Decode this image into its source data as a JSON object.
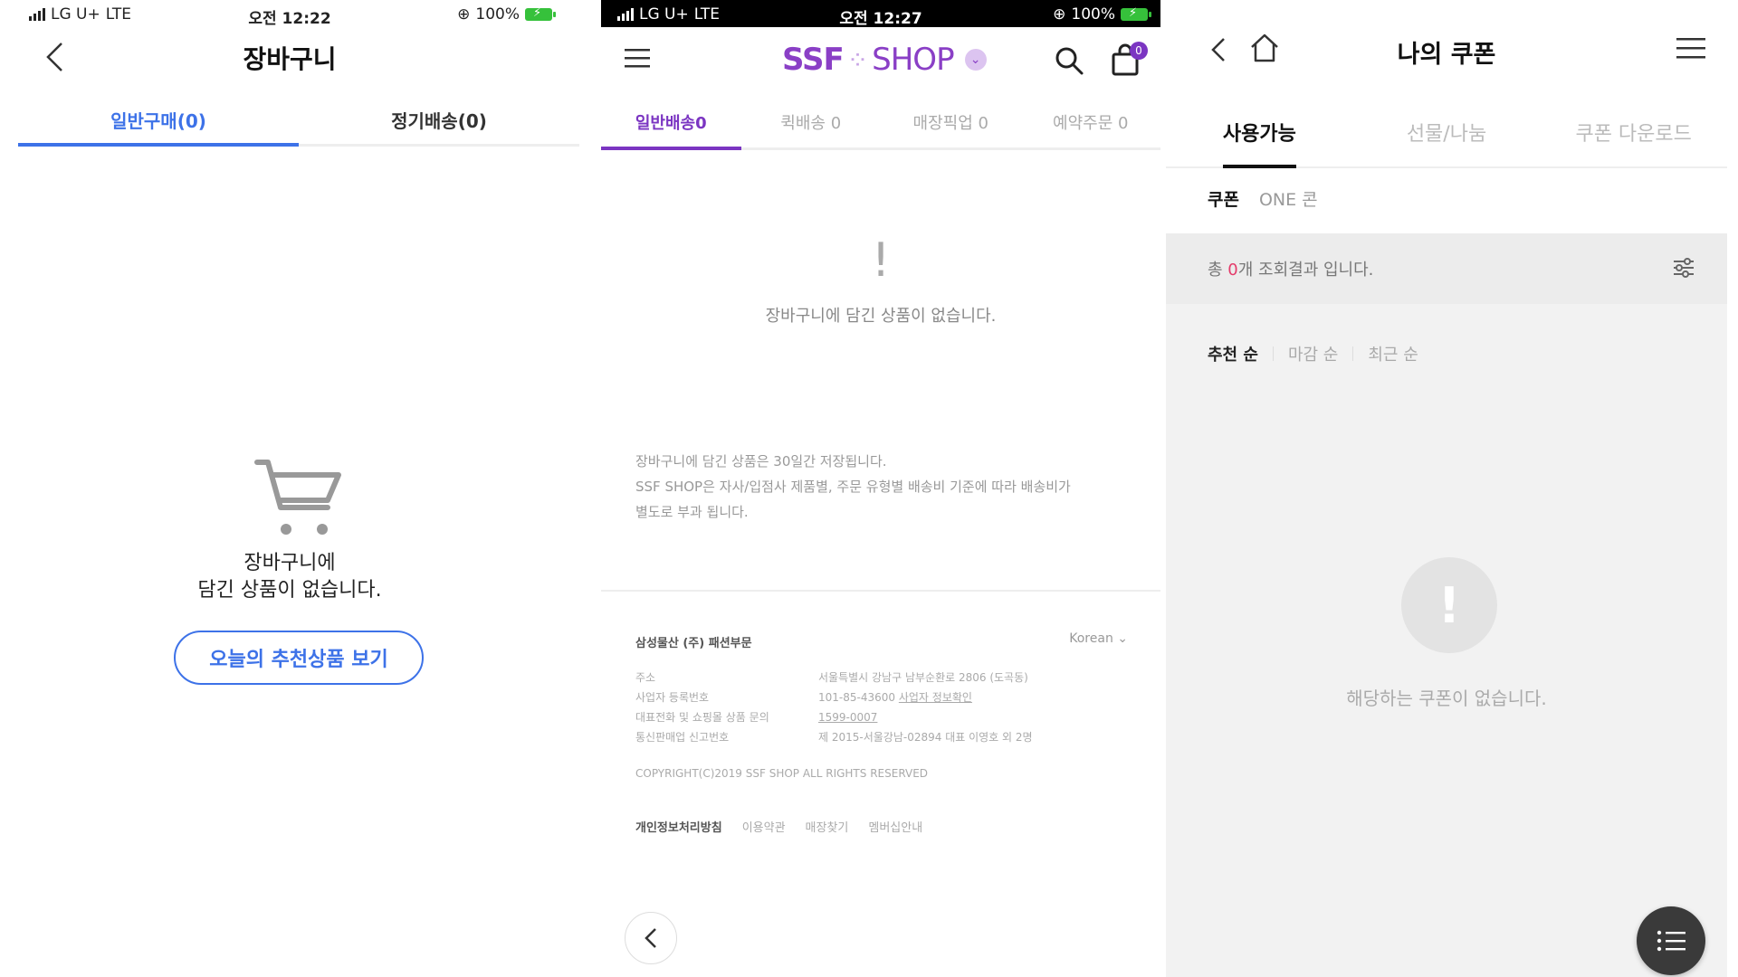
{
  "colors": {
    "blue_accent": "#3d72e8",
    "purple_accent": "#7b35c2",
    "pink_count": "#e43b6a",
    "battery_green": "#36c13b"
  },
  "cart": {
    "status": {
      "carrier": "LG U+",
      "network": "LTE",
      "time": "오전 12:22",
      "battery": "100%"
    },
    "title": "장바구니",
    "tabs": [
      {
        "label": "일반구매(0)",
        "active": true
      },
      {
        "label": "정기배송(0)",
        "active": false
      }
    ],
    "empty_line1": "장바구니에",
    "empty_line2": "담긴 상품이 없습니다.",
    "recommend_button": "오늘의 추천상품 보기"
  },
  "ssf": {
    "status": {
      "carrier": "LG U+",
      "network": "LTE",
      "time": "오전 12:27",
      "battery": "100%"
    },
    "logo": {
      "left": "SSF",
      "right": "SHOP"
    },
    "bag_count": "0",
    "tabs": [
      {
        "label": "일반배송0",
        "active": true
      },
      {
        "label": "퀵배송 0",
        "active": false
      },
      {
        "label": "매장픽업 0",
        "active": false
      },
      {
        "label": "예약주문 0",
        "active": false
      }
    ],
    "empty_icon": "!",
    "empty_text": "장바구니에 담긴 상품이 없습니다.",
    "notice_1": "장바구니에 담긴 상품은 30일간 저장됩니다.",
    "notice_2": "SSF SHOP은 자사/입점사 제품별, 주문 유형별 배송비 기준에 따라 배송비가",
    "notice_3": "별도로 부과 됩니다.",
    "company": "삼성물산 (주) 패션부문",
    "language": "Korean",
    "info": [
      {
        "label": "주소",
        "value": "서울특별시 강남구 남부순환로 2806 (도곡동)"
      },
      {
        "label": "사업자 등록번호",
        "value": "101-85-43600",
        "link": "사업자 정보확인"
      },
      {
        "label": "대표전화 및 쇼핑몰 상품 문의",
        "value": "",
        "link": "1599-0007"
      },
      {
        "label": "통신판매업 신고번호",
        "value": "제 2015-서울강남-02894 대표 이영호 외 2명"
      }
    ],
    "copyright": "COPYRIGHT(C)2019 SSF SHOP ALL RIGHTS RESERVED",
    "footer_links": [
      "개인정보처리방침",
      "이용약관",
      "매장찾기",
      "멤버십안내"
    ]
  },
  "coupon": {
    "title": "나의 쿠폰",
    "tabs": [
      {
        "label": "사용가능",
        "active": true
      },
      {
        "label": "선물/나눔",
        "active": false
      },
      {
        "label": "쿠폰 다운로드",
        "active": false
      }
    ],
    "subtabs": [
      {
        "label": "쿠폰",
        "active": true
      },
      {
        "label": "ONE 콘",
        "active": false
      }
    ],
    "count_prefix": "총 ",
    "count_value": "0",
    "count_suffix": "개 조회결과 입니다.",
    "sort": [
      {
        "label": "추천 순",
        "active": true
      },
      {
        "label": "마감 순",
        "active": false
      },
      {
        "label": "최근 순",
        "active": false
      }
    ],
    "empty_icon": "!",
    "empty_text": "해당하는 쿠폰이 없습니다."
  }
}
